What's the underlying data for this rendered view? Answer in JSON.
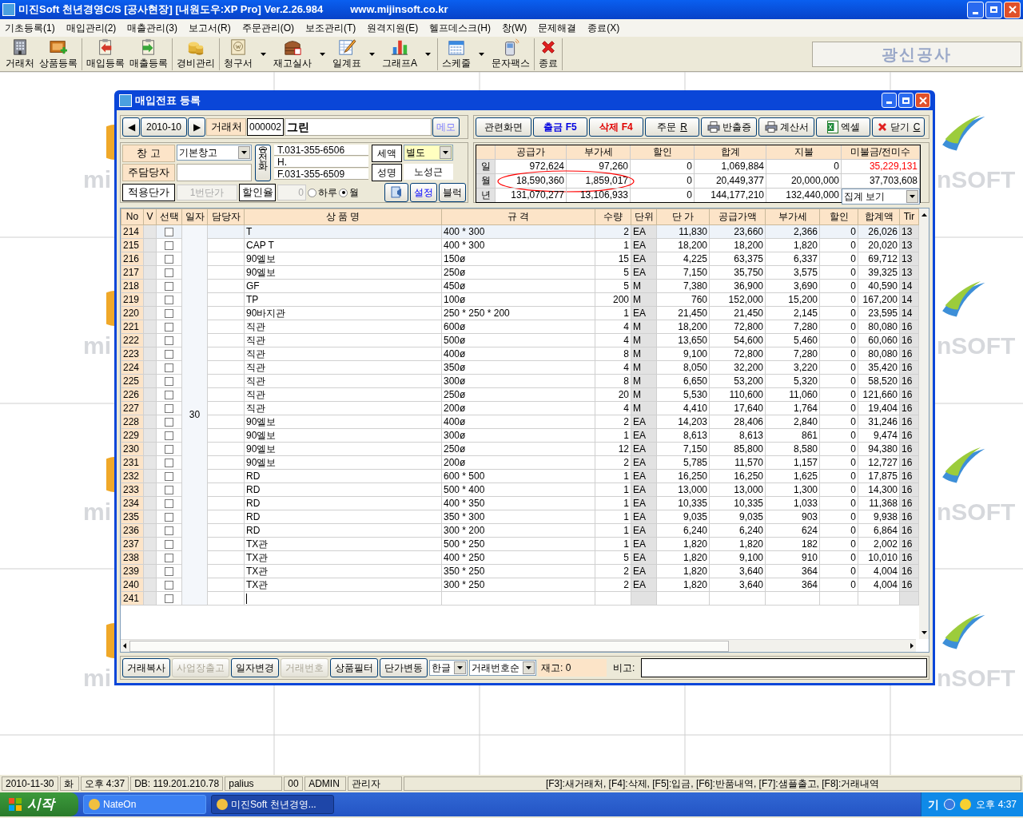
{
  "window": {
    "title": "미진Soft 천년경영C/S [공사현장] [내원도우:XP Pro] Ver.2.26.984",
    "url": "www.mijinsoft.co.kr"
  },
  "menu": [
    "기초등록(1)",
    "매입관리(2)",
    "매출관리(3)",
    "보고서(R)",
    "주문관리(O)",
    "보조관리(T)",
    "원격지원(E)",
    "헬프데스크(H)",
    "창(W)",
    "문제해결",
    "종료(X)"
  ],
  "toolbar": {
    "groups": [
      [
        {
          "label": "거래처",
          "dropdown": false
        },
        {
          "label": "상품등록",
          "dropdown": false
        }
      ],
      [
        {
          "label": "매입등록",
          "dropdown": false
        },
        {
          "label": "매출등록",
          "dropdown": false
        }
      ],
      [
        {
          "label": "경비관리",
          "dropdown": false
        }
      ],
      [
        {
          "label": "청구서",
          "dropdown": true
        },
        {
          "label": "재고실사",
          "dropdown": true
        },
        {
          "label": "일계표",
          "dropdown": true
        },
        {
          "label": "그래프A",
          "dropdown": true
        }
      ],
      [
        {
          "label": "스케줄",
          "dropdown": true
        },
        {
          "label": "문자팩스",
          "dropdown": false
        }
      ],
      [
        {
          "label": "종료",
          "dropdown": false
        }
      ]
    ],
    "company": "광신공사"
  },
  "backdrop": {
    "tiles": [
      {
        "left": "mi",
        "right": "nSOFT"
      },
      {
        "left": "mi",
        "right": "nSOFT"
      },
      {
        "left": "mi",
        "right": "nSOFT"
      },
      {
        "left": "mi",
        "right": "nSOFT"
      }
    ]
  },
  "dialog": {
    "title": "매입전표 등록",
    "period": {
      "prev": "◀",
      "value": "2010-10",
      "next": "▶"
    },
    "client": {
      "label": "거래처",
      "code": "000002",
      "name": "그린",
      "memo": "메모"
    },
    "warehouse": {
      "label": "창 고",
      "value": "기본창고"
    },
    "manager": {
      "label": "주담당자"
    },
    "price_tier": {
      "label": "적용단가",
      "value": "1번단가",
      "disabled": true
    },
    "discount_rate": {
      "label": "할인율",
      "value": "0",
      "disabled": true
    },
    "range_options": [
      {
        "label": "하루",
        "selected": false
      },
      {
        "label": "월",
        "selected": true
      }
    ],
    "phone": {
      "label": "전화",
      "tel": "T.031-355-6506",
      "mobile": "H.",
      "fax": "F.031-355-6509"
    },
    "tax": {
      "label": "세액",
      "value": "별도"
    },
    "contact": {
      "label": "성명",
      "value": "노성근"
    },
    "side_buttons": [
      {
        "label": "설정",
        "kind": "blue"
      },
      {
        "label": "블럭",
        "kind": "plain"
      }
    ],
    "actions": [
      {
        "label": "관련화면",
        "kind": "plain"
      },
      {
        "label": "출금 F5",
        "kind": "blue"
      },
      {
        "label": "삭제 F4",
        "kind": "red"
      },
      {
        "label": "주문",
        "mnemonic": "R",
        "kind": "plain"
      },
      {
        "label": "반출증",
        "kind": "print"
      },
      {
        "label": "계산서",
        "kind": "print"
      },
      {
        "label": "엑셀",
        "kind": "excel"
      },
      {
        "label": "닫기",
        "mnemonic": "C",
        "kind": "close"
      }
    ],
    "summary": {
      "columns": [
        "공급가",
        "부가세",
        "할인",
        "합계",
        "지불",
        "미불금/전미수"
      ],
      "rows": [
        {
          "label": "일",
          "circled": false,
          "values": [
            "972,624",
            "97,260",
            "0",
            "1,069,884",
            "0"
          ],
          "balance": {
            "text": "35,229,131",
            "overdue": true
          }
        },
        {
          "label": "월",
          "circled": true,
          "values": [
            "18,590,360",
            "1,859,017",
            "0",
            "20,449,377",
            "20,000,000"
          ],
          "balance": {
            "text": "37,703,608",
            "overdue": false
          }
        },
        {
          "label": "년",
          "circled": false,
          "values": [
            "131,070,277",
            "13,106,933",
            "0",
            "144,177,210",
            "132,440,000"
          ],
          "view_select": "집계 보기"
        }
      ]
    },
    "table": {
      "columns": [
        "No",
        "V",
        "선택",
        "일자",
        "담당자",
        "상 품 명",
        "규 격",
        "수량",
        "단위",
        "단 가",
        "공급가액",
        "부가세",
        "할인",
        "합계액",
        "Tir"
      ],
      "date": "30",
      "rows": [
        {
          "no": "214",
          "checked": false,
          "cells": [
            "T",
            "400 * 300",
            "2",
            "EA",
            "11,830",
            "23,660",
            "2,366",
            "0",
            "26,026",
            "13"
          ]
        },
        {
          "no": "215",
          "checked": false,
          "cells": [
            "CAP T",
            "400 * 300",
            "1",
            "EA",
            "18,200",
            "18,200",
            "1,820",
            "0",
            "20,020",
            "13"
          ]
        },
        {
          "no": "216",
          "checked": false,
          "cells": [
            "90엘보",
            "150ø",
            "15",
            "EA",
            "4,225",
            "63,375",
            "6,337",
            "0",
            "69,712",
            "13"
          ]
        },
        {
          "no": "217",
          "checked": false,
          "cells": [
            "90엘보",
            "250ø",
            "5",
            "EA",
            "7,150",
            "35,750",
            "3,575",
            "0",
            "39,325",
            "13"
          ]
        },
        {
          "no": "218",
          "checked": false,
          "cells": [
            "GF",
            "450ø",
            "5",
            "M",
            "7,380",
            "36,900",
            "3,690",
            "0",
            "40,590",
            "14"
          ]
        },
        {
          "no": "219",
          "checked": false,
          "cells": [
            "TP",
            "100ø",
            "200",
            "M",
            "760",
            "152,000",
            "15,200",
            "0",
            "167,200",
            "14"
          ]
        },
        {
          "no": "220",
          "checked": false,
          "cells": [
            "90바지관",
            "250 * 250 * 200",
            "1",
            "EA",
            "21,450",
            "21,450",
            "2,145",
            "0",
            "23,595",
            "14"
          ]
        },
        {
          "no": "221",
          "checked": false,
          "cells": [
            "직관",
            "600ø",
            "4",
            "M",
            "18,200",
            "72,800",
            "7,280",
            "0",
            "80,080",
            "16"
          ]
        },
        {
          "no": "222",
          "checked": false,
          "cells": [
            "직관",
            "500ø",
            "4",
            "M",
            "13,650",
            "54,600",
            "5,460",
            "0",
            "60,060",
            "16"
          ]
        },
        {
          "no": "223",
          "checked": false,
          "cells": [
            "직관",
            "400ø",
            "8",
            "M",
            "9,100",
            "72,800",
            "7,280",
            "0",
            "80,080",
            "16"
          ]
        },
        {
          "no": "224",
          "checked": false,
          "cells": [
            "직관",
            "350ø",
            "4",
            "M",
            "8,050",
            "32,200",
            "3,220",
            "0",
            "35,420",
            "16"
          ]
        },
        {
          "no": "225",
          "checked": false,
          "cells": [
            "직관",
            "300ø",
            "8",
            "M",
            "6,650",
            "53,200",
            "5,320",
            "0",
            "58,520",
            "16"
          ]
        },
        {
          "no": "226",
          "checked": false,
          "cells": [
            "직관",
            "250ø",
            "20",
            "M",
            "5,530",
            "110,600",
            "11,060",
            "0",
            "121,660",
            "16"
          ]
        },
        {
          "no": "227",
          "checked": false,
          "cells": [
            "직관",
            "200ø",
            "4",
            "M",
            "4,410",
            "17,640",
            "1,764",
            "0",
            "19,404",
            "16"
          ]
        },
        {
          "no": "228",
          "checked": false,
          "cells": [
            "90엘보",
            "400ø",
            "2",
            "EA",
            "14,203",
            "28,406",
            "2,840",
            "0",
            "31,246",
            "16"
          ]
        },
        {
          "no": "229",
          "checked": false,
          "cells": [
            "90엘보",
            "300ø",
            "1",
            "EA",
            "8,613",
            "8,613",
            "861",
            "0",
            "9,474",
            "16"
          ]
        },
        {
          "no": "230",
          "checked": false,
          "cells": [
            "90엘보",
            "250ø",
            "12",
            "EA",
            "7,150",
            "85,800",
            "8,580",
            "0",
            "94,380",
            "16"
          ]
        },
        {
          "no": "231",
          "checked": false,
          "cells": [
            "90엘보",
            "200ø",
            "2",
            "EA",
            "5,785",
            "11,570",
            "1,157",
            "0",
            "12,727",
            "16"
          ]
        },
        {
          "no": "232",
          "checked": false,
          "cells": [
            "RD",
            "600 * 500",
            "1",
            "EA",
            "16,250",
            "16,250",
            "1,625",
            "0",
            "17,875",
            "16"
          ]
        },
        {
          "no": "233",
          "checked": false,
          "cells": [
            "RD",
            "500 * 400",
            "1",
            "EA",
            "13,000",
            "13,000",
            "1,300",
            "0",
            "14,300",
            "16"
          ]
        },
        {
          "no": "234",
          "checked": false,
          "cells": [
            "RD",
            "400 * 350",
            "1",
            "EA",
            "10,335",
            "10,335",
            "1,033",
            "0",
            "11,368",
            "16"
          ]
        },
        {
          "no": "235",
          "checked": false,
          "cells": [
            "RD",
            "350 * 300",
            "1",
            "EA",
            "9,035",
            "9,035",
            "903",
            "0",
            "9,938",
            "16"
          ]
        },
        {
          "no": "236",
          "checked": false,
          "cells": [
            "RD",
            "300 * 200",
            "1",
            "EA",
            "6,240",
            "6,240",
            "624",
            "0",
            "6,864",
            "16"
          ]
        },
        {
          "no": "237",
          "checked": false,
          "cells": [
            "TX관",
            "500 * 250",
            "1",
            "EA",
            "1,820",
            "1,820",
            "182",
            "0",
            "2,002",
            "16"
          ]
        },
        {
          "no": "238",
          "checked": false,
          "cells": [
            "TX관",
            "400 * 250",
            "5",
            "EA",
            "1,820",
            "9,100",
            "910",
            "0",
            "10,010",
            "16"
          ]
        },
        {
          "no": "239",
          "checked": false,
          "cells": [
            "TX관",
            "350 * 250",
            "2",
            "EA",
            "1,820",
            "3,640",
            "364",
            "0",
            "4,004",
            "16"
          ]
        },
        {
          "no": "240",
          "checked": false,
          "cells": [
            "TX관",
            "300 * 250",
            "2",
            "EA",
            "1,820",
            "3,640",
            "364",
            "0",
            "4,004",
            "16"
          ]
        },
        {
          "no": "241",
          "checked": false
        }
      ]
    },
    "bottom": {
      "buttons": [
        {
          "label": "거래복사",
          "disabled": false
        },
        {
          "label": "사업장출고",
          "disabled": true
        },
        {
          "label": "일자변경",
          "disabled": false
        },
        {
          "label": "거래번호",
          "disabled": true
        },
        {
          "label": "상품필터",
          "disabled": false
        },
        {
          "label": "단가변동",
          "disabled": false
        }
      ],
      "selects": [
        "한글",
        "거래번호순"
      ],
      "stock": "재고: 0",
      "note_label": "비고:"
    }
  },
  "status_bar": [
    "2010-11-30",
    "화",
    "오후 4:37",
    "DB: 119.201.210.78",
    "palius",
    "00",
    "ADMIN",
    "관리자",
    "[F3]:새거래처, [F4]:삭제, [F5]:입금, [F6]:반품내역, [F7]:샘플출고, [F8]:거래내역"
  ],
  "taskbar": {
    "start": "시작",
    "tasks": [
      {
        "label": "NateOn",
        "selected": false
      },
      {
        "label": "미진Soft 천년경영...",
        "selected": true
      }
    ],
    "ime": "기",
    "clock": "오후 4:37"
  }
}
